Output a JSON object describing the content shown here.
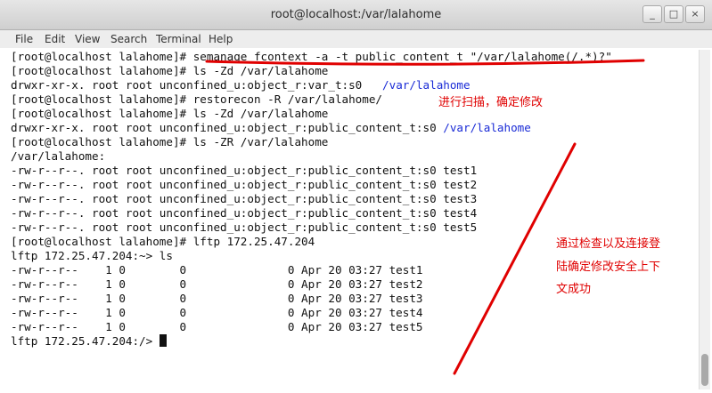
{
  "window": {
    "title": "root@localhost:/var/lalahome",
    "controls": [
      "_",
      "□",
      "×"
    ]
  },
  "menu": [
    "File",
    "Edit",
    "View",
    "Search",
    "Terminal",
    "Help"
  ],
  "terminal": {
    "lines": [
      "[root@localhost lalahome]# semanage fcontext -a -t public_content_t \"/var/lalahome(/.*)?\"",
      "[root@localhost lalahome]# ls -Zd /var/lalahome",
      "drwxr-xr-x. root root unconfined_u:object_r:var_t:s0",
      "[root@localhost lalahome]# restorecon -R /var/lalahome/",
      "[root@localhost lalahome]# ls -Zd /var/lalahome",
      "drwxr-xr-x. root root unconfined_u:object_r:public_content_t:s0",
      "[root@localhost lalahome]# ls -ZR /var/lalahome",
      "/var/lalahome:",
      "-rw-r--r--. root root unconfined_u:object_r:public_content_t:s0 test1",
      "-rw-r--r--. root root unconfined_u:object_r:public_content_t:s0 test2",
      "-rw-r--r--. root root unconfined_u:object_r:public_content_t:s0 test3",
      "-rw-r--r--. root root unconfined_u:object_r:public_content_t:s0 test4",
      "-rw-r--r--. root root unconfined_u:object_r:public_content_t:s0 test5",
      "[root@localhost lalahome]# lftp 172.25.47.204",
      "lftp 172.25.47.204:~> ls",
      "-rw-r--r--    1 0        0               0 Apr 20 03:27 test1",
      "-rw-r--r--    1 0        0               0 Apr 20 03:27 test2",
      "-rw-r--r--    1 0        0               0 Apr 20 03:27 test3",
      "-rw-r--r--    1 0        0               0 Apr 20 03:27 test4",
      "-rw-r--r--    1 0        0               0 Apr 20 03:27 test5",
      "lftp 172.25.47.204:/> "
    ],
    "blue_path_1": "/var/lalahome",
    "blue_path_2": "/var/lalahome"
  },
  "annotations": {
    "note_scan": "进行扫描，确定修改",
    "note_check_1": "通过检查以及连接登",
    "note_check_2": "陆确定修改安全上下",
    "note_check_3": "文成功"
  },
  "colors": {
    "annotation": "#e00000",
    "path_blue": "#1a2bd6",
    "terminal_bg": "#ffffff"
  }
}
